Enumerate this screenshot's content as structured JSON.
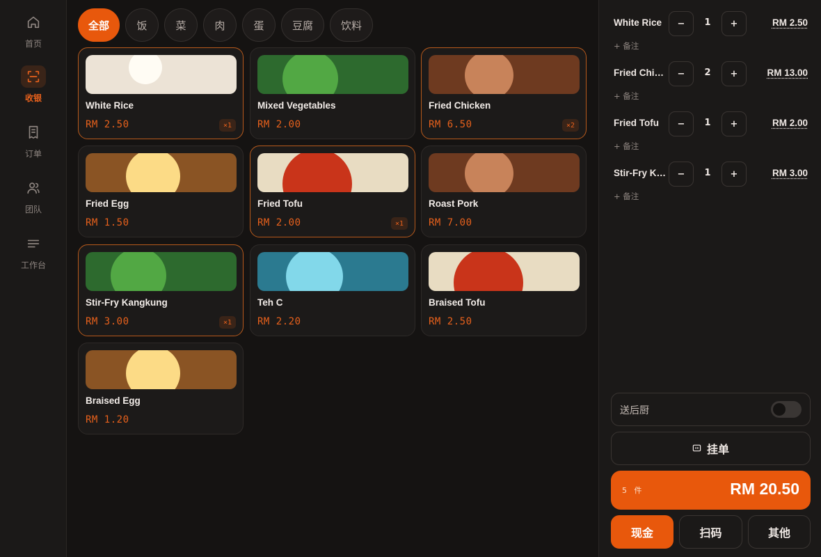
{
  "sidebar": {
    "items": [
      {
        "label": "首页",
        "icon": "home-icon",
        "active": false
      },
      {
        "label": "收银",
        "icon": "scan-icon",
        "active": true
      },
      {
        "label": "订单",
        "icon": "receipt-icon",
        "active": false
      },
      {
        "label": "团队",
        "icon": "team-icon",
        "active": false
      },
      {
        "label": "工作台",
        "icon": "menu-lines-icon",
        "active": false
      }
    ]
  },
  "categories": [
    {
      "label": "全部",
      "active": true
    },
    {
      "label": "饭",
      "active": false
    },
    {
      "label": "菜",
      "active": false
    },
    {
      "label": "肉",
      "active": false
    },
    {
      "label": "蛋",
      "active": false
    },
    {
      "label": "豆腐",
      "active": false
    },
    {
      "label": "饮料",
      "active": false
    }
  ],
  "products": [
    {
      "name": "White Rice",
      "price": "RM 2.50",
      "badge": "×1",
      "bg": "#ece3d6",
      "blob": "#fffcf4"
    },
    {
      "name": "Mixed Vegetables",
      "price": "RM 2.00",
      "badge": "",
      "bg": "#2d6a2e",
      "blob": "#52a844"
    },
    {
      "name": "Fried Chicken",
      "price": "RM 6.50",
      "badge": "×2",
      "bg": "#6e3a20",
      "blob": "#c8835a"
    },
    {
      "name": "Fried Egg",
      "price": "RM 1.50",
      "badge": "",
      "bg": "#8a5424",
      "blob": "#fcdb86"
    },
    {
      "name": "Fried Tofu",
      "price": "RM 2.00",
      "badge": "×1",
      "bg": "#e8dcc2",
      "blob": "#c9341a"
    },
    {
      "name": "Roast Pork",
      "price": "RM 7.00",
      "badge": "",
      "bg": "#6e3a20",
      "blob": "#c8835a"
    },
    {
      "name": "Stir-Fry Kangkung",
      "price": "RM 3.00",
      "badge": "×1",
      "bg": "#2d6a2e",
      "blob": "#52a844"
    },
    {
      "name": "Teh C",
      "price": "RM 2.20",
      "badge": "",
      "bg": "#2b7a90",
      "blob": "#82d8ea"
    },
    {
      "name": "Braised Tofu",
      "price": "RM 2.50",
      "badge": "",
      "bg": "#e8dcc2",
      "blob": "#c9341a"
    },
    {
      "name": "Braised Egg",
      "price": "RM 1.20",
      "badge": "",
      "bg": "#8a5424",
      "blob": "#fcdb86"
    }
  ],
  "cart": {
    "lines": [
      {
        "name": "White Rice",
        "qty": "1",
        "total": "RM 2.50",
        "note": "+ 备注"
      },
      {
        "name": "Fried Chicken",
        "qty": "2",
        "total": "RM 13.00",
        "note": "+ 备注"
      },
      {
        "name": "Fried Tofu",
        "qty": "1",
        "total": "RM 2.00",
        "note": "+ 备注"
      },
      {
        "name": "Stir-Fry Kangkung",
        "qty": "1",
        "total": "RM 3.00",
        "note": "+ 备注"
      }
    ],
    "minus": "−",
    "plus": "+",
    "send_kitchen_label": "送后厨",
    "send_kitchen_on": false,
    "hold_label": "挂单",
    "item_count": "5",
    "item_unit": "件",
    "grand_total": "RM 20.50",
    "pay_methods": [
      "现金",
      "扫码",
      "其他"
    ]
  },
  "colors": {
    "accent": "#e8580c",
    "background": "#151312",
    "panel": "#1b1918"
  }
}
